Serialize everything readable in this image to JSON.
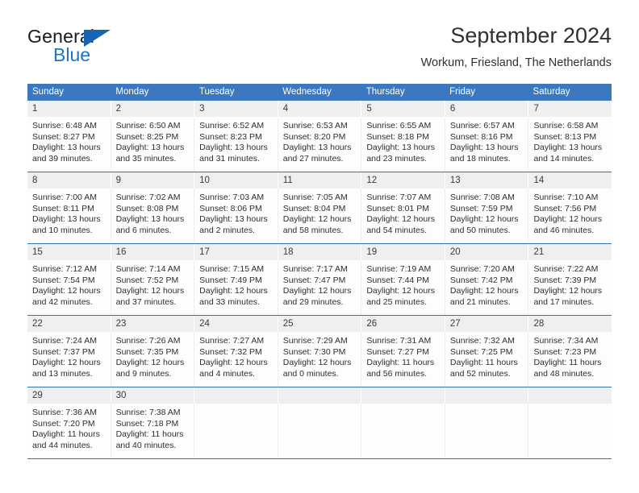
{
  "brand": {
    "name_part1": "General",
    "name_part2": "Blue",
    "accent_color": "#1b74c4",
    "triangle_color": "#1565b0",
    "triangle_icon": "triangle-logo-icon"
  },
  "header": {
    "title": "September 2024",
    "subtitle": "Workum, Friesland, The Netherlands"
  },
  "calendar": {
    "header_bg": "#3b78bf",
    "daynum_bg": "#efefef",
    "weekdays": [
      "Sunday",
      "Monday",
      "Tuesday",
      "Wednesday",
      "Thursday",
      "Friday",
      "Saturday"
    ],
    "weeks": [
      {
        "days": [
          {
            "num": "1",
            "sunrise": "Sunrise: 6:48 AM",
            "sunset": "Sunset: 8:27 PM",
            "daylight1": "Daylight: 13 hours",
            "daylight2": "and 39 minutes."
          },
          {
            "num": "2",
            "sunrise": "Sunrise: 6:50 AM",
            "sunset": "Sunset: 8:25 PM",
            "daylight1": "Daylight: 13 hours",
            "daylight2": "and 35 minutes."
          },
          {
            "num": "3",
            "sunrise": "Sunrise: 6:52 AM",
            "sunset": "Sunset: 8:23 PM",
            "daylight1": "Daylight: 13 hours",
            "daylight2": "and 31 minutes."
          },
          {
            "num": "4",
            "sunrise": "Sunrise: 6:53 AM",
            "sunset": "Sunset: 8:20 PM",
            "daylight1": "Daylight: 13 hours",
            "daylight2": "and 27 minutes."
          },
          {
            "num": "5",
            "sunrise": "Sunrise: 6:55 AM",
            "sunset": "Sunset: 8:18 PM",
            "daylight1": "Daylight: 13 hours",
            "daylight2": "and 23 minutes."
          },
          {
            "num": "6",
            "sunrise": "Sunrise: 6:57 AM",
            "sunset": "Sunset: 8:16 PM",
            "daylight1": "Daylight: 13 hours",
            "daylight2": "and 18 minutes."
          },
          {
            "num": "7",
            "sunrise": "Sunrise: 6:58 AM",
            "sunset": "Sunset: 8:13 PM",
            "daylight1": "Daylight: 13 hours",
            "daylight2": "and 14 minutes."
          }
        ]
      },
      {
        "days": [
          {
            "num": "8",
            "sunrise": "Sunrise: 7:00 AM",
            "sunset": "Sunset: 8:11 PM",
            "daylight1": "Daylight: 13 hours",
            "daylight2": "and 10 minutes."
          },
          {
            "num": "9",
            "sunrise": "Sunrise: 7:02 AM",
            "sunset": "Sunset: 8:08 PM",
            "daylight1": "Daylight: 13 hours",
            "daylight2": "and 6 minutes."
          },
          {
            "num": "10",
            "sunrise": "Sunrise: 7:03 AM",
            "sunset": "Sunset: 8:06 PM",
            "daylight1": "Daylight: 13 hours",
            "daylight2": "and 2 minutes."
          },
          {
            "num": "11",
            "sunrise": "Sunrise: 7:05 AM",
            "sunset": "Sunset: 8:04 PM",
            "daylight1": "Daylight: 12 hours",
            "daylight2": "and 58 minutes."
          },
          {
            "num": "12",
            "sunrise": "Sunrise: 7:07 AM",
            "sunset": "Sunset: 8:01 PM",
            "daylight1": "Daylight: 12 hours",
            "daylight2": "and 54 minutes."
          },
          {
            "num": "13",
            "sunrise": "Sunrise: 7:08 AM",
            "sunset": "Sunset: 7:59 PM",
            "daylight1": "Daylight: 12 hours",
            "daylight2": "and 50 minutes."
          },
          {
            "num": "14",
            "sunrise": "Sunrise: 7:10 AM",
            "sunset": "Sunset: 7:56 PM",
            "daylight1": "Daylight: 12 hours",
            "daylight2": "and 46 minutes."
          }
        ]
      },
      {
        "days": [
          {
            "num": "15",
            "sunrise": "Sunrise: 7:12 AM",
            "sunset": "Sunset: 7:54 PM",
            "daylight1": "Daylight: 12 hours",
            "daylight2": "and 42 minutes."
          },
          {
            "num": "16",
            "sunrise": "Sunrise: 7:14 AM",
            "sunset": "Sunset: 7:52 PM",
            "daylight1": "Daylight: 12 hours",
            "daylight2": "and 37 minutes."
          },
          {
            "num": "17",
            "sunrise": "Sunrise: 7:15 AM",
            "sunset": "Sunset: 7:49 PM",
            "daylight1": "Daylight: 12 hours",
            "daylight2": "and 33 minutes."
          },
          {
            "num": "18",
            "sunrise": "Sunrise: 7:17 AM",
            "sunset": "Sunset: 7:47 PM",
            "daylight1": "Daylight: 12 hours",
            "daylight2": "and 29 minutes."
          },
          {
            "num": "19",
            "sunrise": "Sunrise: 7:19 AM",
            "sunset": "Sunset: 7:44 PM",
            "daylight1": "Daylight: 12 hours",
            "daylight2": "and 25 minutes."
          },
          {
            "num": "20",
            "sunrise": "Sunrise: 7:20 AM",
            "sunset": "Sunset: 7:42 PM",
            "daylight1": "Daylight: 12 hours",
            "daylight2": "and 21 minutes."
          },
          {
            "num": "21",
            "sunrise": "Sunrise: 7:22 AM",
            "sunset": "Sunset: 7:39 PM",
            "daylight1": "Daylight: 12 hours",
            "daylight2": "and 17 minutes."
          }
        ]
      },
      {
        "days": [
          {
            "num": "22",
            "sunrise": "Sunrise: 7:24 AM",
            "sunset": "Sunset: 7:37 PM",
            "daylight1": "Daylight: 12 hours",
            "daylight2": "and 13 minutes."
          },
          {
            "num": "23",
            "sunrise": "Sunrise: 7:26 AM",
            "sunset": "Sunset: 7:35 PM",
            "daylight1": "Daylight: 12 hours",
            "daylight2": "and 9 minutes."
          },
          {
            "num": "24",
            "sunrise": "Sunrise: 7:27 AM",
            "sunset": "Sunset: 7:32 PM",
            "daylight1": "Daylight: 12 hours",
            "daylight2": "and 4 minutes."
          },
          {
            "num": "25",
            "sunrise": "Sunrise: 7:29 AM",
            "sunset": "Sunset: 7:30 PM",
            "daylight1": "Daylight: 12 hours",
            "daylight2": "and 0 minutes."
          },
          {
            "num": "26",
            "sunrise": "Sunrise: 7:31 AM",
            "sunset": "Sunset: 7:27 PM",
            "daylight1": "Daylight: 11 hours",
            "daylight2": "and 56 minutes."
          },
          {
            "num": "27",
            "sunrise": "Sunrise: 7:32 AM",
            "sunset": "Sunset: 7:25 PM",
            "daylight1": "Daylight: 11 hours",
            "daylight2": "and 52 minutes."
          },
          {
            "num": "28",
            "sunrise": "Sunrise: 7:34 AM",
            "sunset": "Sunset: 7:23 PM",
            "daylight1": "Daylight: 11 hours",
            "daylight2": "and 48 minutes."
          }
        ]
      },
      {
        "days": [
          {
            "num": "29",
            "sunrise": "Sunrise: 7:36 AM",
            "sunset": "Sunset: 7:20 PM",
            "daylight1": "Daylight: 11 hours",
            "daylight2": "and 44 minutes."
          },
          {
            "num": "30",
            "sunrise": "Sunrise: 7:38 AM",
            "sunset": "Sunset: 7:18 PM",
            "daylight1": "Daylight: 11 hours",
            "daylight2": "and 40 minutes."
          },
          {
            "num": "",
            "sunrise": "",
            "sunset": "",
            "daylight1": "",
            "daylight2": ""
          },
          {
            "num": "",
            "sunrise": "",
            "sunset": "",
            "daylight1": "",
            "daylight2": ""
          },
          {
            "num": "",
            "sunrise": "",
            "sunset": "",
            "daylight1": "",
            "daylight2": ""
          },
          {
            "num": "",
            "sunrise": "",
            "sunset": "",
            "daylight1": "",
            "daylight2": ""
          },
          {
            "num": "",
            "sunrise": "",
            "sunset": "",
            "daylight1": "",
            "daylight2": ""
          }
        ]
      }
    ]
  }
}
